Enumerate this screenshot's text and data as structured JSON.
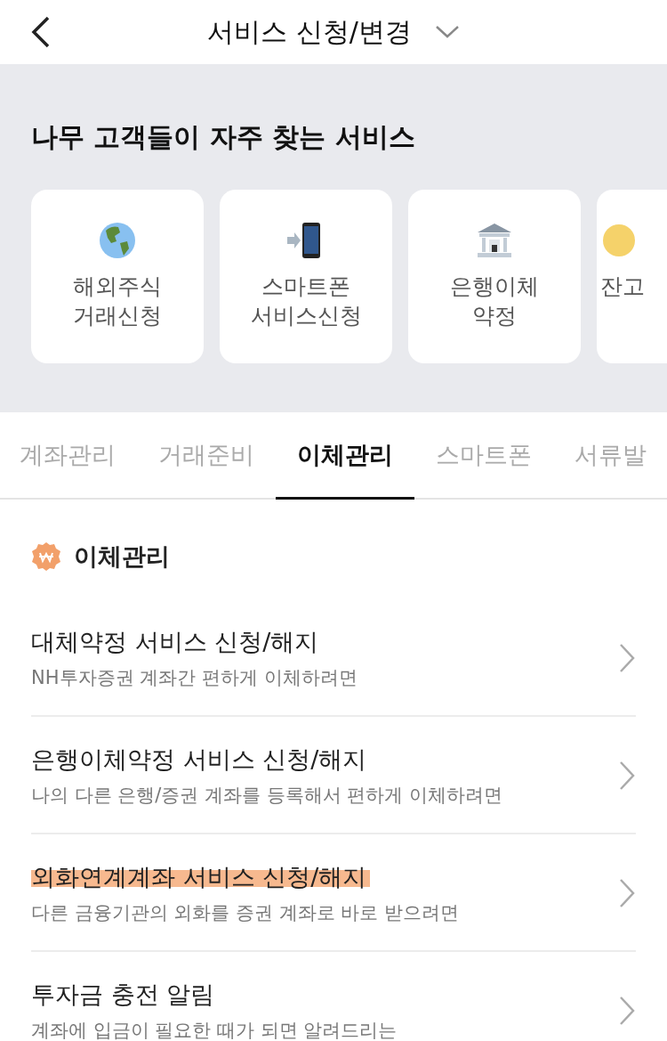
{
  "header": {
    "title": "서비스 신청/변경"
  },
  "favorites": {
    "title": "나무 고객들이 자주 찾는 서비스",
    "cards": [
      {
        "kind": "globe",
        "lines": [
          "해외주식",
          "거래신청"
        ]
      },
      {
        "kind": "phone",
        "lines": [
          "스마트폰",
          "서비스신청"
        ]
      },
      {
        "kind": "bank",
        "lines": [
          "은행이체",
          "약정"
        ]
      },
      {
        "kind": "coin",
        "lines": [
          "잔고"
        ]
      }
    ]
  },
  "tabs": [
    {
      "label": "계좌관리",
      "selected": false
    },
    {
      "label": "거래준비",
      "selected": false
    },
    {
      "label": "이체관리",
      "selected": true
    },
    {
      "label": "스마트폰",
      "selected": false
    },
    {
      "label": "서류발",
      "selected": false
    }
  ],
  "section": {
    "title": "이체관리"
  },
  "items": [
    {
      "title": "대체약정 서비스 신청/해지",
      "subtitle": "NH투자증권 계좌간 편하게 이체하려면",
      "highlighted": false
    },
    {
      "title": "은행이체약정 서비스 신청/해지",
      "subtitle": "나의 다른 은행/증권 계좌를 등록해서 편하게 이체하려면",
      "highlighted": false
    },
    {
      "title": "외화연계계좌 서비스 신청/해지",
      "subtitle": "다른 금융기관의 외화를 증권 계좌로 바로 받으려면",
      "highlighted": true
    },
    {
      "title": "투자금 충전 알림",
      "subtitle": "계좌에 입금이 필요한 때가 되면 알려드리는",
      "highlighted": false
    }
  ]
}
